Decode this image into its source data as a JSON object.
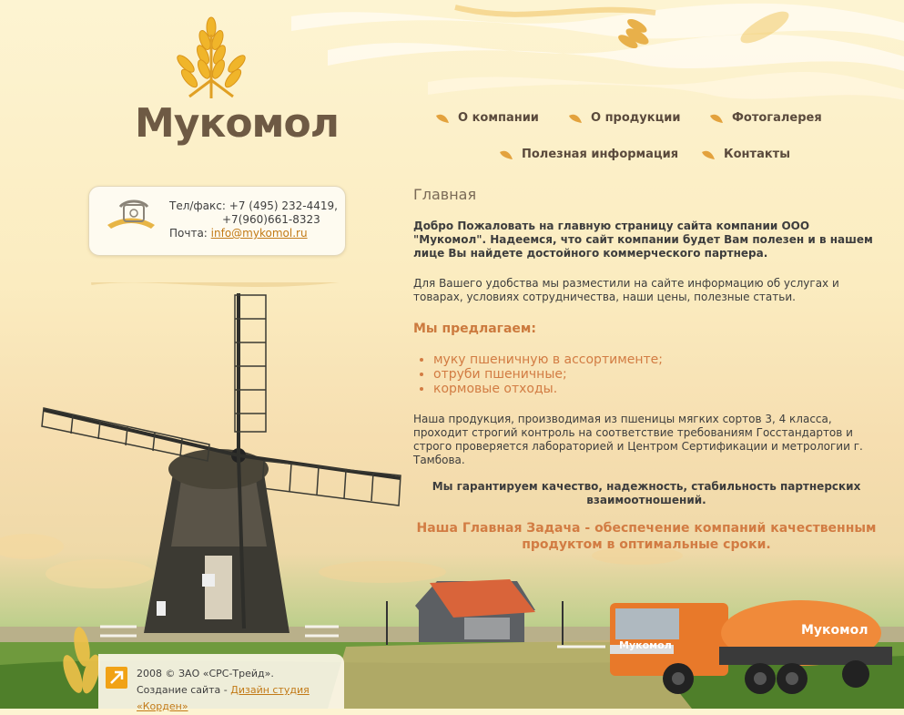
{
  "brand": {
    "name": "Мукомол"
  },
  "nav": {
    "items": [
      {
        "label": "О компании"
      },
      {
        "label": "О продукции"
      },
      {
        "label": "Фотогалерея"
      },
      {
        "label": "Полезная информация"
      },
      {
        "label": "Контакты"
      }
    ]
  },
  "contact": {
    "phone_label": "Тел/факс:",
    "phone1": "+7 (495) 232-4419,",
    "phone2": "+7(960)661-8323",
    "email_label": "Почта:",
    "email": "info@mykomol.ru"
  },
  "content": {
    "heading": "Главная",
    "welcome": "Добро Пожаловать на главную страницу сайта компании ООО \"Мукомол\". Надеемся, что сайт компании будет Вам полезен и в нашем лице Вы найдете достойного коммерческого партнера.",
    "convenience": "Для Вашего удобства мы разместили на сайте информацию об услугах и товарах, условиях сотрудничества, наши цены, полезные статьи.",
    "offer_heading": "Мы предлагаем:",
    "offers": [
      "муку пшеничную в ассортименте;",
      "отруби пшеничные;",
      "кормовые отходы."
    ],
    "product_text": "Наша продукция, производимая из пшеницы мягких сортов 3, 4 класса, проходит строгий контроль на соответствие требованиям Госстандартов и строго проверяется лабораторией и Центром Сертификации и метрологии г. Тамбова.",
    "guarantee": "Мы гарантируем качество, надежность, стабильность партнерских взаимоотношений.",
    "mission": "Наша Главная Задача - обеспечение компаний качественным продуктом в оптимальные сроки."
  },
  "truck": {
    "label": "Мукомол"
  },
  "footer": {
    "copyright": "2008 © ЗАО «СРС-Трейд».",
    "created_label": "Создание сайта -",
    "studio_link": "Дизайн студия «Корден»"
  },
  "colors": {
    "accent": "#d27c43",
    "link": "#c27a17",
    "text": "#3d3d3d",
    "logo": "#6e5a44"
  }
}
